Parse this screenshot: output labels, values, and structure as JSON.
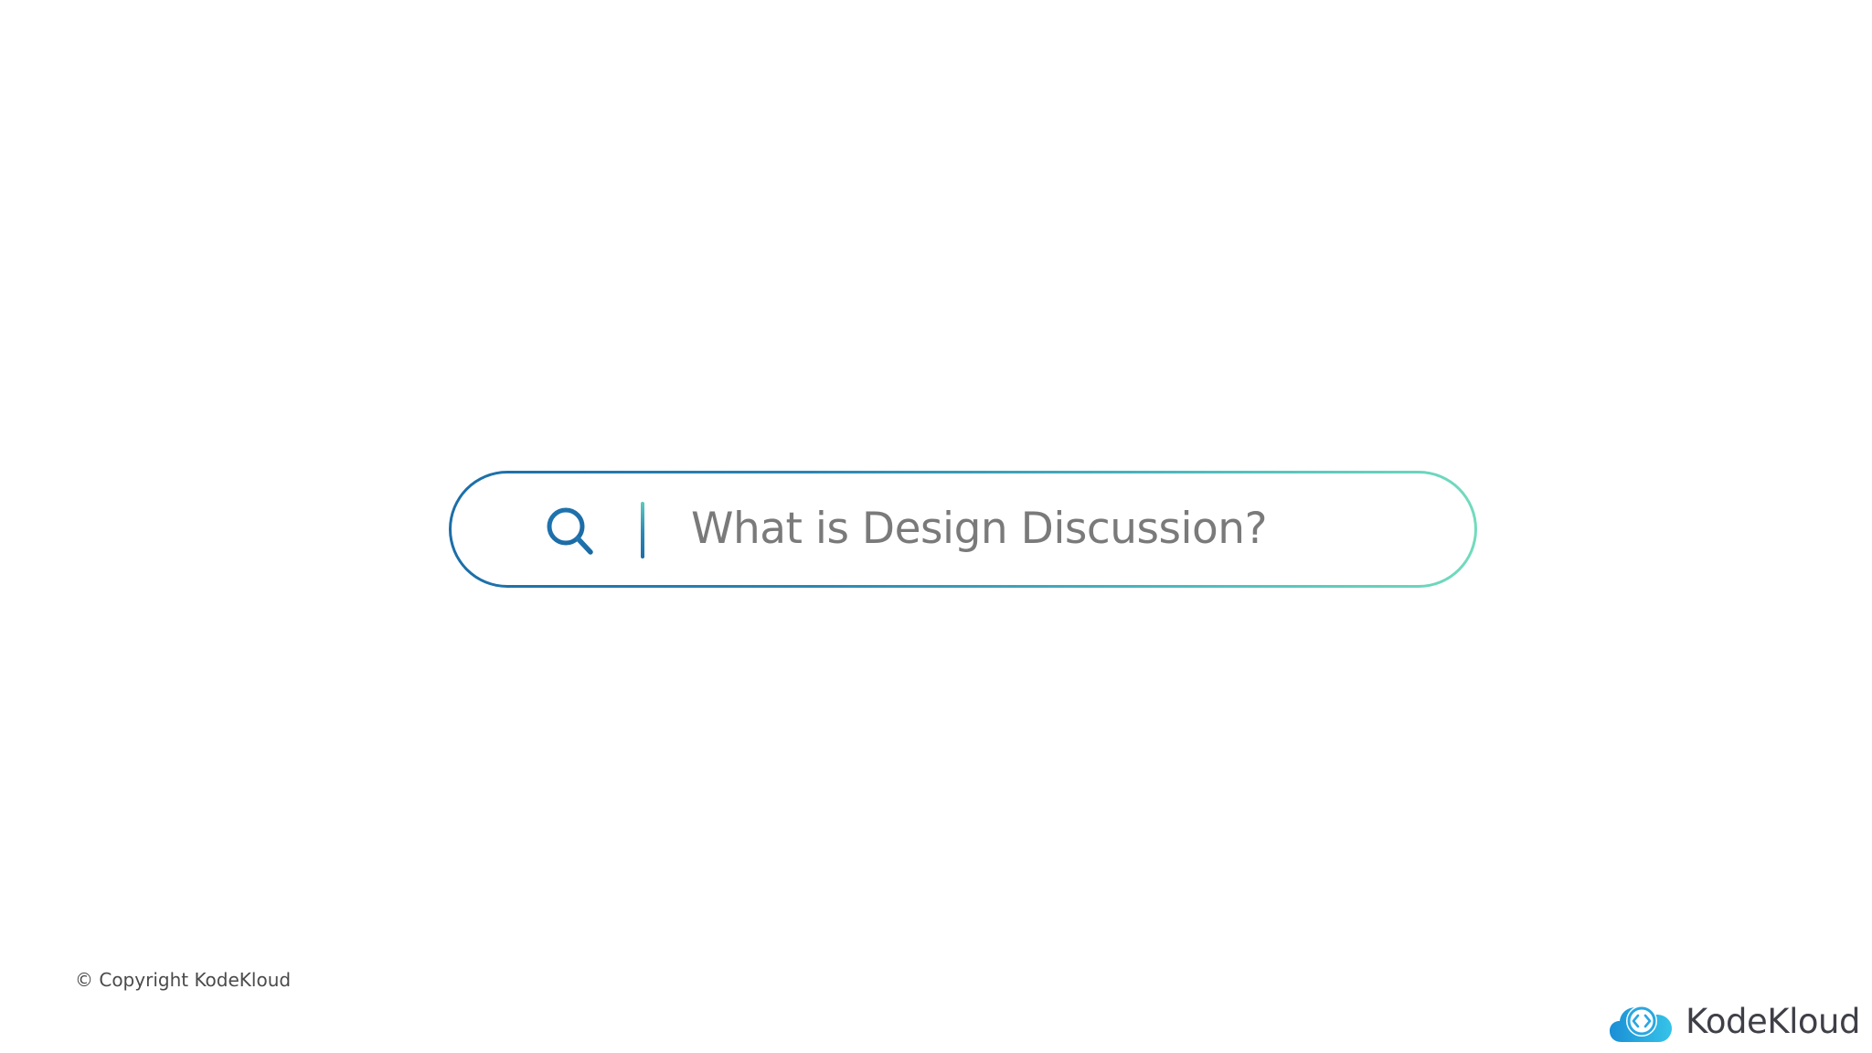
{
  "search": {
    "query": "What is Design Discussion?",
    "icon": "search-icon"
  },
  "footer": {
    "copyright": "© Copyright KodeKloud"
  },
  "brand": {
    "name": "KodeKloud",
    "icon": "kodekloud-cloud-logo"
  },
  "colors": {
    "gradient_start": "#1c6ea8",
    "gradient_end": "#72dbbd",
    "query_text": "#7a7a7a",
    "brand_text": "#3f3f48"
  }
}
